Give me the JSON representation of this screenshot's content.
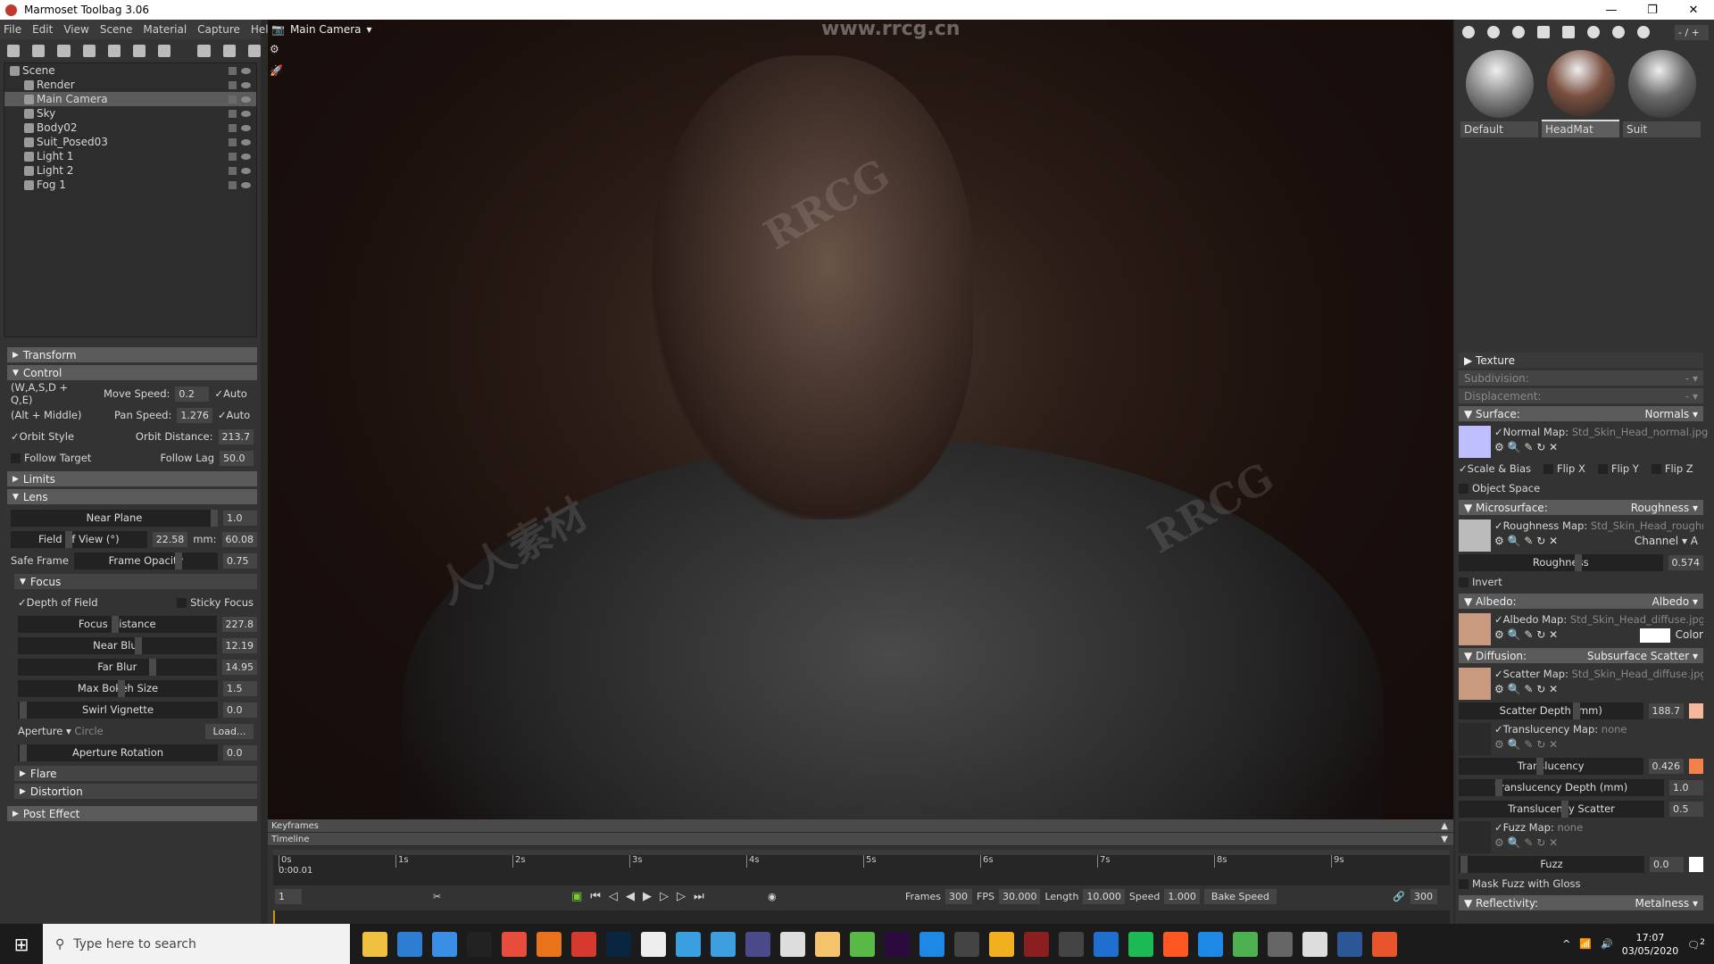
{
  "window": {
    "title": "Marmoset Toolbag 3.06",
    "watermark_url": "www.rrcg.cn",
    "watermark_text": "RRCG",
    "watermark_cn": "人人素材"
  },
  "menu": [
    "File",
    "Edit",
    "View",
    "Scene",
    "Material",
    "Capture",
    "Help"
  ],
  "scene_tree": [
    {
      "label": "Scene",
      "icon": "scene-icon"
    },
    {
      "label": "Render",
      "icon": "gear-icon"
    },
    {
      "label": "Main Camera",
      "icon": "camera-icon",
      "selected": true
    },
    {
      "label": "Sky",
      "icon": "sky-icon"
    },
    {
      "label": "Body02",
      "icon": "mesh-icon"
    },
    {
      "label": "Suit_Posed03",
      "icon": "mesh-icon"
    },
    {
      "label": "Light 1",
      "icon": "bulb-icon"
    },
    {
      "label": "Light 2",
      "icon": "bulb-icon"
    },
    {
      "label": "Fog 1",
      "icon": "fog-icon"
    }
  ],
  "camera_props": {
    "transform": "Transform",
    "control": "Control",
    "wasd": "(W,A,S,D + Q,E)",
    "move_speed_label": "Move Speed:",
    "move_speed": "0.2",
    "auto": "Auto",
    "alt": "(Alt + Middle)",
    "pan_speed_label": "Pan Speed:",
    "pan_speed": "1.276",
    "orbit_style": "Orbit Style",
    "orbit_distance_label": "Orbit Distance:",
    "orbit_distance": "213.7",
    "follow_target": "Follow Target",
    "follow_lag_label": "Follow Lag",
    "follow_lag": "50.0",
    "limits": "Limits",
    "lens": "Lens",
    "near_plane": "Near Plane",
    "near_plane_val": "1.0",
    "fov": "Field of View (°)",
    "fov_val": "22.58",
    "mm_label": "mm:",
    "mm_val": "60.08",
    "safe_frame": "Safe Frame",
    "frame_opacity": "Frame Opacity",
    "frame_opacity_val": "0.75",
    "focus": "Focus",
    "dof": "Depth of Field",
    "sticky_focus": "Sticky Focus",
    "focus_distance": "Focus Distance",
    "focus_distance_val": "227.8",
    "near_blur": "Near Blur",
    "near_blur_val": "12.19",
    "far_blur": "Far Blur",
    "far_blur_val": "14.95",
    "max_bokeh": "Max Bokeh Size",
    "max_bokeh_val": "1.5",
    "swirl": "Swirl Vignette",
    "swirl_val": "0.0",
    "aperture": "Aperture",
    "aperture_shape": "Circle",
    "load": "Load...",
    "aperture_rotation": "Aperture Rotation",
    "aperture_rotation_val": "0.0",
    "flare": "Flare",
    "distortion": "Distortion",
    "post_effect": "Post Effect"
  },
  "viewport": {
    "camera": "Main Camera"
  },
  "timeline": {
    "keyframes": "Keyframes",
    "timeline": "Timeline",
    "ticks": [
      "0s",
      "1s",
      "2s",
      "3s",
      "4s",
      "5s",
      "6s",
      "7s",
      "8s",
      "9s"
    ],
    "current_time": "0:00.01",
    "frame": "1",
    "frames_label": "Frames",
    "frames": "300",
    "fps_label": "FPS",
    "fps": "30.000",
    "length_label": "Length",
    "length": "10.000",
    "speed_label": "Speed",
    "speed": "1.000",
    "bake_speed": "Bake Speed",
    "end_frame": "300"
  },
  "materials": {
    "page": "- / +",
    "items": [
      {
        "label": "Default",
        "color": "#8a8a8a"
      },
      {
        "label": "HeadMat",
        "color": "#7a5040",
        "selected": true
      },
      {
        "label": "Suit",
        "color": "#6a6a6a"
      }
    ]
  },
  "material_props": {
    "texture": "Texture",
    "subdivision": "Subdivision:",
    "subdivision_val": "-",
    "displacement": "Displacement:",
    "displacement_val": "-",
    "surface": "Surface:",
    "surface_val": "Normals",
    "normal_map": "Normal Map:",
    "normal_file": "Std_Skin_Head_normal.jpg",
    "scale_bias": "Scale & Bias",
    "flip_x": "Flip X",
    "flip_y": "Flip Y",
    "flip_z": "Flip Z",
    "object_space": "Object Space",
    "microsurface": "Microsurface:",
    "microsurface_val": "Roughness",
    "roughness_map": "Roughness Map:",
    "roughness_file": "Std_Skin_Head_roughness",
    "channel": "Channel",
    "channel_val": "A",
    "roughness": "Roughness",
    "roughness_val": "0.574",
    "invert": "Invert",
    "albedo": "Albedo:",
    "albedo_val": "Albedo",
    "albedo_map": "Albedo Map:",
    "albedo_file": "Std_Skin_Head_diffuse.jpg",
    "color": "Color",
    "diffusion": "Diffusion:",
    "diffusion_val": "Subsurface Scatter",
    "scatter_map": "Scatter Map:",
    "scatter_file": "Std_Skin_Head_diffuse.jpg",
    "scatter_depth": "Scatter Depth (mm)",
    "scatter_depth_val": "188.7",
    "scatter_color": "#f7b79a",
    "translucency_map": "Translucency Map:",
    "none": "none",
    "translucency": "Translucency",
    "translucency_val": "0.426",
    "translucency_color": "#f2814a",
    "translucency_depth": "Translucency Depth (mm)",
    "translucency_depth_val": "1.0",
    "translucency_scatter": "Translucency Scatter",
    "translucency_scatter_val": "0.5",
    "fuzz_map": "Fuzz Map:",
    "fuzz": "Fuzz",
    "fuzz_val": "0.0",
    "mask_fuzz": "Mask Fuzz with Gloss",
    "reflectivity": "Reflectivity:",
    "reflectivity_val": "Metalness"
  },
  "taskbar": {
    "search_placeholder": "Type here to search",
    "time": "17:07",
    "date": "03/05/2020",
    "notifications": "2",
    "apps": [
      "#f0c040",
      "#2d7dd2",
      "#3a8ee6",
      "#222",
      "#e84c3d",
      "#e8731a",
      "#d63a2e",
      "#0a2540",
      "#eee",
      "#3a9fe0",
      "#3d9fe0",
      "#4a4a8a",
      "#ddd",
      "#f5c36b",
      "#59b947",
      "#2b0a3d",
      "#1e88e5",
      "#444",
      "#f0b020",
      "#8b1e1e",
      "#444",
      "#1e6fd0",
      "#1db954",
      "#ff5722",
      "#1e88e5",
      "#4caf50",
      "#666",
      "#ddd",
      "#2b5797",
      "#e8542b"
    ]
  }
}
